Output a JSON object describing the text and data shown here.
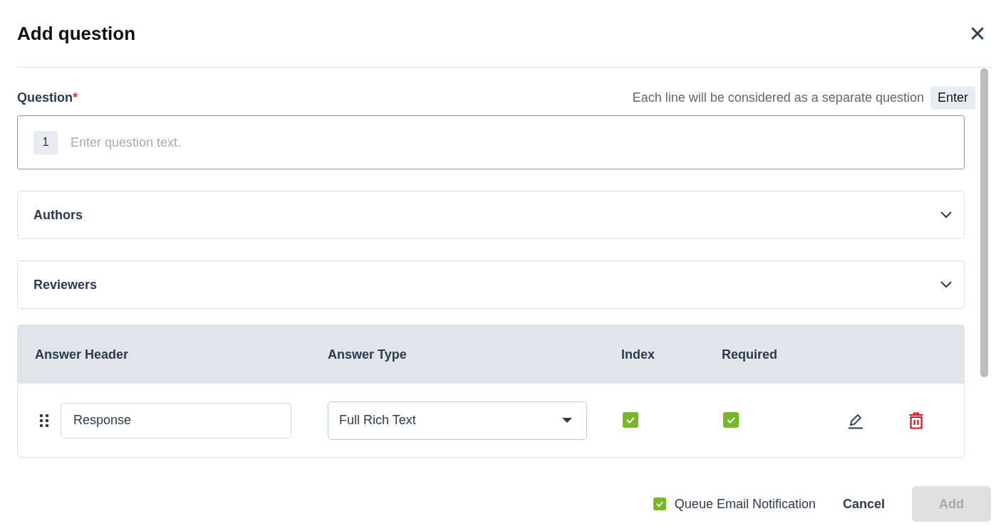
{
  "dialog": {
    "title": "Add question"
  },
  "question": {
    "label": "Question",
    "required_mark": "*",
    "hint": "Each line will be considered as a separate question",
    "key_hint": "Enter",
    "line_number": "1",
    "placeholder": "Enter question text."
  },
  "sections": [
    {
      "label": "Authors",
      "expanded": false
    },
    {
      "label": "Reviewers",
      "expanded": false
    }
  ],
  "answers_table": {
    "columns": [
      "Answer Header",
      "Answer Type",
      "Index",
      "Required"
    ],
    "rows": [
      {
        "header": "Response",
        "type": "Full Rich Text",
        "index": true,
        "required": true
      }
    ]
  },
  "footer": {
    "queue_email": {
      "label": "Queue Email Notification",
      "checked": true
    },
    "cancel": "Cancel",
    "add": {
      "label": "Add",
      "disabled": true
    }
  }
}
